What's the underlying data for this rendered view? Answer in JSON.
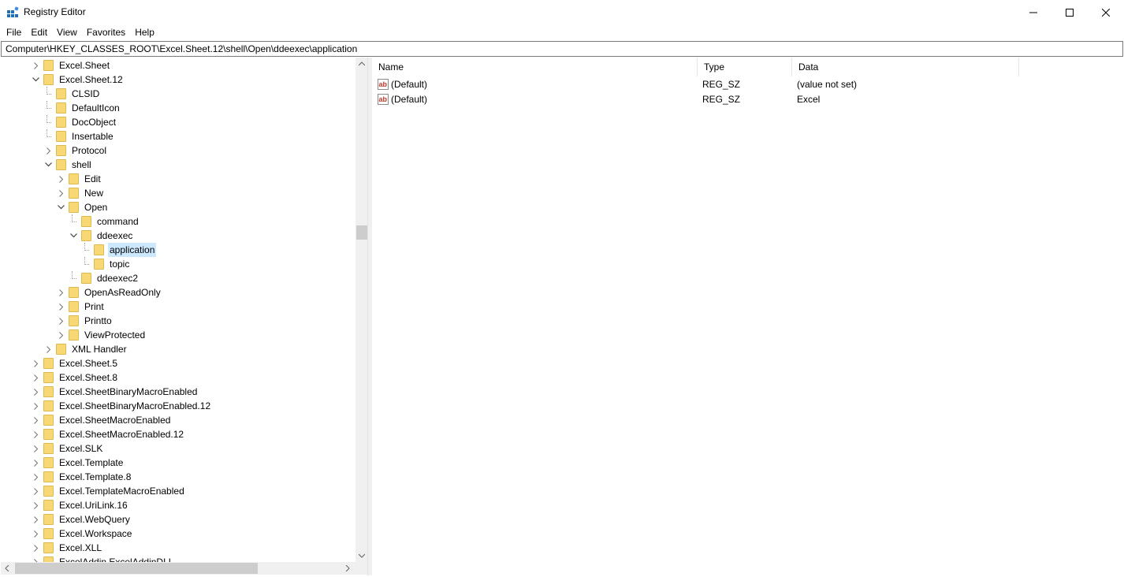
{
  "window": {
    "title": "Registry Editor"
  },
  "menu": [
    "File",
    "Edit",
    "View",
    "Favorites",
    "Help"
  ],
  "address": "Computer\\HKEY_CLASSES_ROOT\\Excel.Sheet.12\\shell\\Open\\ddeexec\\application",
  "tree": [
    {
      "label": "Excel.Sheet",
      "level": 0,
      "expander": "collapsed"
    },
    {
      "label": "Excel.Sheet.12",
      "level": 0,
      "expander": "expanded"
    },
    {
      "label": "CLSID",
      "level": 1,
      "expander": "none"
    },
    {
      "label": "DefaultIcon",
      "level": 1,
      "expander": "none"
    },
    {
      "label": "DocObject",
      "level": 1,
      "expander": "none"
    },
    {
      "label": "Insertable",
      "level": 1,
      "expander": "none"
    },
    {
      "label": "Protocol",
      "level": 1,
      "expander": "collapsed"
    },
    {
      "label": "shell",
      "level": 1,
      "expander": "expanded"
    },
    {
      "label": "Edit",
      "level": 2,
      "expander": "collapsed"
    },
    {
      "label": "New",
      "level": 2,
      "expander": "collapsed"
    },
    {
      "label": "Open",
      "level": 2,
      "expander": "expanded"
    },
    {
      "label": "command",
      "level": 3,
      "expander": "none"
    },
    {
      "label": "ddeexec",
      "level": 3,
      "expander": "expanded"
    },
    {
      "label": "application",
      "level": 4,
      "expander": "none",
      "selected": true
    },
    {
      "label": "topic",
      "level": 4,
      "expander": "none"
    },
    {
      "label": "ddeexec2",
      "level": 3,
      "expander": "none"
    },
    {
      "label": "OpenAsReadOnly",
      "level": 2,
      "expander": "collapsed"
    },
    {
      "label": "Print",
      "level": 2,
      "expander": "collapsed"
    },
    {
      "label": "Printto",
      "level": 2,
      "expander": "collapsed"
    },
    {
      "label": "ViewProtected",
      "level": 2,
      "expander": "collapsed"
    },
    {
      "label": "XML Handler",
      "level": 1,
      "expander": "collapsed"
    },
    {
      "label": "Excel.Sheet.5",
      "level": 0,
      "expander": "collapsed"
    },
    {
      "label": "Excel.Sheet.8",
      "level": 0,
      "expander": "collapsed"
    },
    {
      "label": "Excel.SheetBinaryMacroEnabled",
      "level": 0,
      "expander": "collapsed"
    },
    {
      "label": "Excel.SheetBinaryMacroEnabled.12",
      "level": 0,
      "expander": "collapsed"
    },
    {
      "label": "Excel.SheetMacroEnabled",
      "level": 0,
      "expander": "collapsed"
    },
    {
      "label": "Excel.SheetMacroEnabled.12",
      "level": 0,
      "expander": "collapsed"
    },
    {
      "label": "Excel.SLK",
      "level": 0,
      "expander": "collapsed"
    },
    {
      "label": "Excel.Template",
      "level": 0,
      "expander": "collapsed"
    },
    {
      "label": "Excel.Template.8",
      "level": 0,
      "expander": "collapsed"
    },
    {
      "label": "Excel.TemplateMacroEnabled",
      "level": 0,
      "expander": "collapsed"
    },
    {
      "label": "Excel.UriLink.16",
      "level": 0,
      "expander": "collapsed"
    },
    {
      "label": "Excel.WebQuery",
      "level": 0,
      "expander": "collapsed"
    },
    {
      "label": "Excel.Workspace",
      "level": 0,
      "expander": "collapsed"
    },
    {
      "label": "Excel.XLL",
      "level": 0,
      "expander": "collapsed"
    },
    {
      "label": "ExcelAddin.ExcelAddinDLL",
      "level": 0,
      "expander": "collapsed"
    }
  ],
  "list": {
    "columns": [
      "Name",
      "Type",
      "Data"
    ],
    "rows": [
      {
        "name": "(Default)",
        "type": "REG_SZ",
        "data": "(value not set)"
      },
      {
        "name": "(Default)",
        "type": "REG_SZ",
        "data": "Excel"
      }
    ]
  },
  "colors": {
    "selection": "#cce8ff",
    "folder": "#f8d775",
    "icon_blue": "#1f6fb5",
    "string_icon_red": "#c0392b"
  },
  "icons": {
    "app": "registry-editor-icon",
    "minimize": "minimize-icon",
    "maximize": "maximize-icon",
    "close": "close-icon",
    "folder": "folder-icon",
    "string_value": "string-value-icon"
  }
}
